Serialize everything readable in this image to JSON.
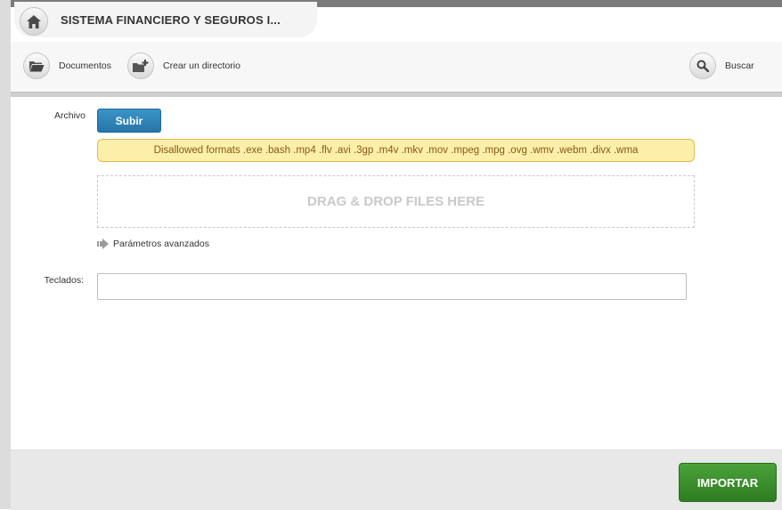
{
  "breadcrumb": {
    "title": "SISTEMA FINANCIERO Y SEGUROS I..."
  },
  "toolbar": {
    "documents_label": "Documentos",
    "create_dir_label": "Crear un directorio",
    "search_label": "Buscar"
  },
  "form": {
    "archivo_label": "Archivo",
    "upload_label": "Subir",
    "disallowed_text": "Disallowed formats .exe .bash .mp4 .flv .avi .3gp .m4v .mkv .mov .mpeg .mpg .ovg .wmv .webm .divx .wma",
    "dropzone_text": "DRAG & DROP FILES HERE",
    "advanced_label": "Parámetros avanzados",
    "teclados_label": "Teclados:",
    "teclados_value": ""
  },
  "footer": {
    "import_label": "IMPORTAR"
  },
  "icons": {
    "home": "home-icon",
    "documents": "folder-open-icon",
    "create_dir": "folder-add-icon",
    "search": "search-icon",
    "advanced": "arrow-right-icon"
  },
  "colors": {
    "upload_button": "#2f86bd",
    "warning_bg": "#fbefaa",
    "warning_border": "#e5b94a",
    "import_button": "#3b8f2d"
  }
}
